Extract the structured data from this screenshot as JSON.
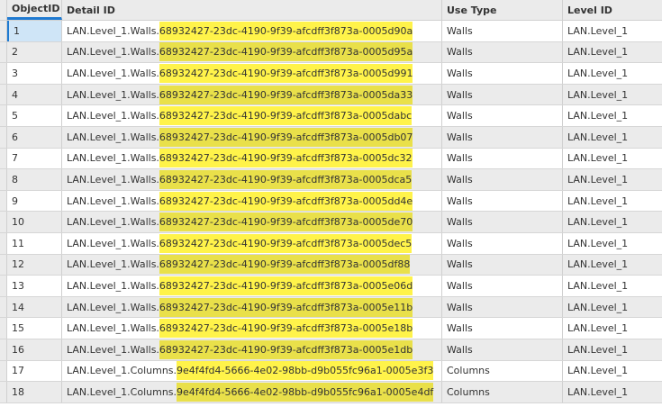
{
  "columns": {
    "object_id": "ObjectID *",
    "detail_id": "Detail ID",
    "use_type": "Use Type",
    "level_id": "Level ID"
  },
  "rows": [
    {
      "object_id": "1",
      "prefix": "LAN.Level_1.Walls.",
      "guid": "68932427-23dc-4190-9f39-afcdff3f873a-0005d90a",
      "use_type": "Walls",
      "level_id": "LAN.Level_1"
    },
    {
      "object_id": "2",
      "prefix": "LAN.Level_1.Walls.",
      "guid": "68932427-23dc-4190-9f39-afcdff3f873a-0005d95a",
      "use_type": "Walls",
      "level_id": "LAN.Level_1"
    },
    {
      "object_id": "3",
      "prefix": "LAN.Level_1.Walls.",
      "guid": "68932427-23dc-4190-9f39-afcdff3f873a-0005d991",
      "use_type": "Walls",
      "level_id": "LAN.Level_1"
    },
    {
      "object_id": "4",
      "prefix": "LAN.Level_1.Walls.",
      "guid": "68932427-23dc-4190-9f39-afcdff3f873a-0005da33",
      "use_type": "Walls",
      "level_id": "LAN.Level_1"
    },
    {
      "object_id": "5",
      "prefix": "LAN.Level_1.Walls.",
      "guid": "68932427-23dc-4190-9f39-afcdff3f873a-0005dabc",
      "use_type": "Walls",
      "level_id": "LAN.Level_1"
    },
    {
      "object_id": "6",
      "prefix": "LAN.Level_1.Walls.",
      "guid": "68932427-23dc-4190-9f39-afcdff3f873a-0005db07",
      "use_type": "Walls",
      "level_id": "LAN.Level_1"
    },
    {
      "object_id": "7",
      "prefix": "LAN.Level_1.Walls.",
      "guid": "68932427-23dc-4190-9f39-afcdff3f873a-0005dc32",
      "use_type": "Walls",
      "level_id": "LAN.Level_1"
    },
    {
      "object_id": "8",
      "prefix": "LAN.Level_1.Walls.",
      "guid": "68932427-23dc-4190-9f39-afcdff3f873a-0005dca5",
      "use_type": "Walls",
      "level_id": "LAN.Level_1"
    },
    {
      "object_id": "9",
      "prefix": "LAN.Level_1.Walls.",
      "guid": "68932427-23dc-4190-9f39-afcdff3f873a-0005dd4e",
      "use_type": "Walls",
      "level_id": "LAN.Level_1"
    },
    {
      "object_id": "10",
      "prefix": "LAN.Level_1.Walls.",
      "guid": "68932427-23dc-4190-9f39-afcdff3f873a-0005de70",
      "use_type": "Walls",
      "level_id": "LAN.Level_1"
    },
    {
      "object_id": "11",
      "prefix": "LAN.Level_1.Walls.",
      "guid": "68932427-23dc-4190-9f39-afcdff3f873a-0005dec5",
      "use_type": "Walls",
      "level_id": "LAN.Level_1"
    },
    {
      "object_id": "12",
      "prefix": "LAN.Level_1.Walls.",
      "guid": "68932427-23dc-4190-9f39-afcdff3f873a-0005df88",
      "use_type": "Walls",
      "level_id": "LAN.Level_1"
    },
    {
      "object_id": "13",
      "prefix": "LAN.Level_1.Walls.",
      "guid": "68932427-23dc-4190-9f39-afcdff3f873a-0005e06d",
      "use_type": "Walls",
      "level_id": "LAN.Level_1"
    },
    {
      "object_id": "14",
      "prefix": "LAN.Level_1.Walls.",
      "guid": "68932427-23dc-4190-9f39-afcdff3f873a-0005e11b",
      "use_type": "Walls",
      "level_id": "LAN.Level_1"
    },
    {
      "object_id": "15",
      "prefix": "LAN.Level_1.Walls.",
      "guid": "68932427-23dc-4190-9f39-afcdff3f873a-0005e18b",
      "use_type": "Walls",
      "level_id": "LAN.Level_1"
    },
    {
      "object_id": "16",
      "prefix": "LAN.Level_1.Walls.",
      "guid": "68932427-23dc-4190-9f39-afcdff3f873a-0005e1db",
      "use_type": "Walls",
      "level_id": "LAN.Level_1"
    },
    {
      "object_id": "17",
      "prefix": "LAN.Level_1.Columns.",
      "guid": "9e4f4fd4-5666-4e02-98bb-d9b055fc96a1-0005e3f3",
      "use_type": "Columns",
      "level_id": "LAN.Level_1"
    },
    {
      "object_id": "18",
      "prefix": "LAN.Level_1.Columns.",
      "guid": "9e4f4fd4-5666-4e02-98bb-d9b055fc96a1-0005e4df",
      "use_type": "Columns",
      "level_id": "LAN.Level_1"
    }
  ],
  "colors": {
    "highlight": "#fff34a",
    "selection": "#cfe5f7",
    "accent": "#1f7ad1"
  }
}
